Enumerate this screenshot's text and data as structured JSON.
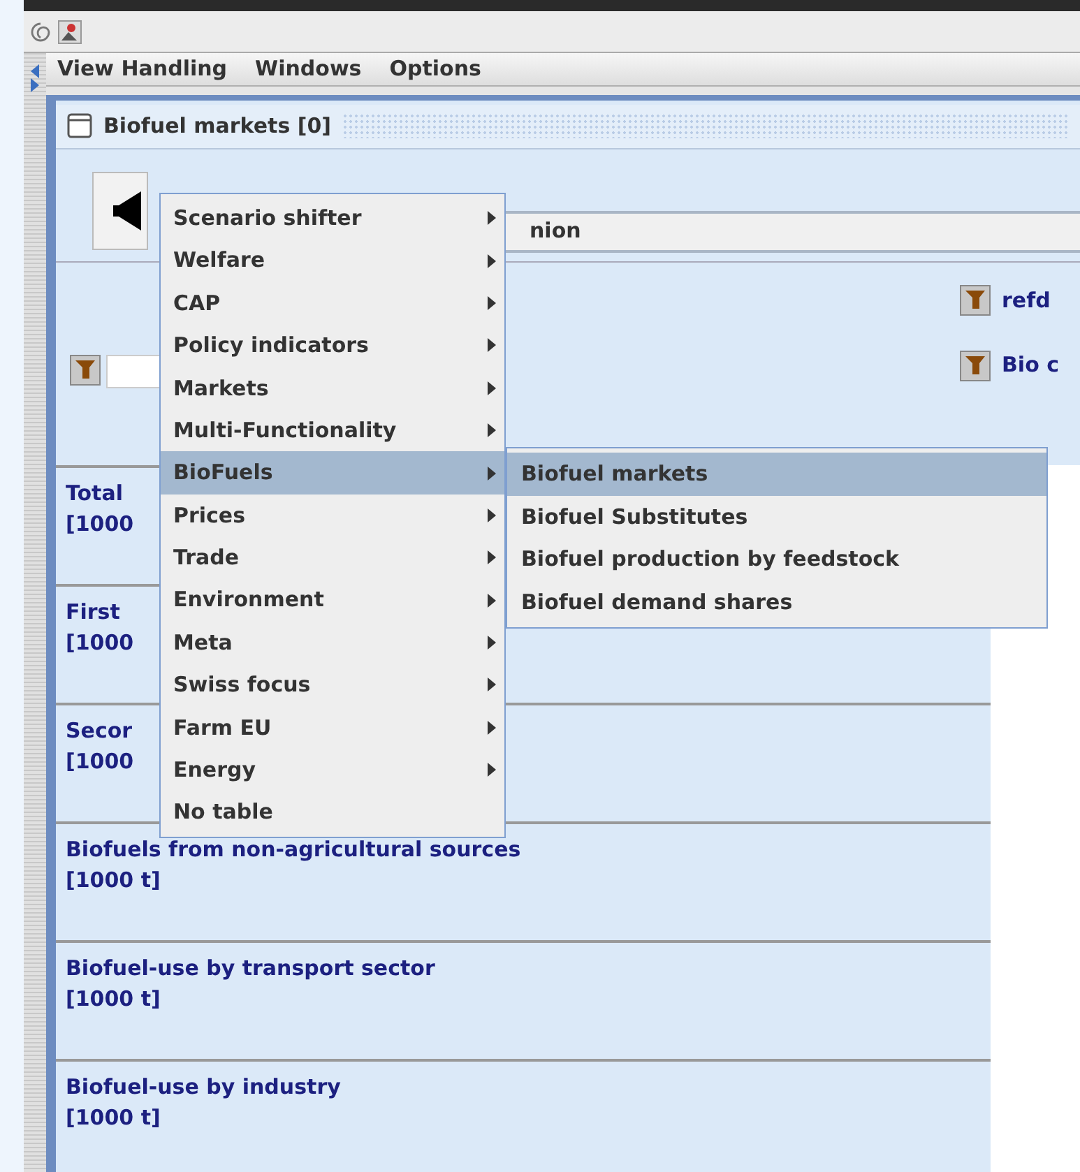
{
  "menubar": [
    {
      "label": "View Handling"
    },
    {
      "label": "Windows"
    },
    {
      "label": "Options"
    }
  ],
  "frame": {
    "title": "Biofuel markets [0]"
  },
  "combo": {
    "value": "nion"
  },
  "side_links": [
    {
      "label": "refd"
    },
    {
      "label": "Bio c"
    }
  ],
  "rows": [
    {
      "title": "Total",
      "unit": "[1000"
    },
    {
      "title": "First",
      "unit": "[1000"
    },
    {
      "title": "Secor",
      "unit": "[1000"
    },
    {
      "title": "Biofuels from non-agricultural sources",
      "unit": "[1000 t]"
    },
    {
      "title": "Biofuel-use by transport sector",
      "unit": "[1000 t]"
    },
    {
      "title": "Biofuel-use by industry",
      "unit": "[1000 t]"
    }
  ],
  "menu": [
    {
      "label": "Scenario shifter",
      "submenu": true,
      "selected": false
    },
    {
      "label": "Welfare",
      "submenu": true,
      "selected": false
    },
    {
      "label": "CAP",
      "submenu": true,
      "selected": false
    },
    {
      "label": "Policy indicators",
      "submenu": true,
      "selected": false
    },
    {
      "label": "Markets",
      "submenu": true,
      "selected": false
    },
    {
      "label": "Multi-Functionality",
      "submenu": true,
      "selected": false
    },
    {
      "label": "BioFuels",
      "submenu": true,
      "selected": true
    },
    {
      "label": "Prices",
      "submenu": true,
      "selected": false
    },
    {
      "label": "Trade",
      "submenu": true,
      "selected": false
    },
    {
      "label": "Environment",
      "submenu": true,
      "selected": false
    },
    {
      "label": "Meta",
      "submenu": true,
      "selected": false
    },
    {
      "label": "Swiss focus",
      "submenu": true,
      "selected": false
    },
    {
      "label": "Farm EU",
      "submenu": true,
      "selected": false
    },
    {
      "label": "Energy",
      "submenu": true,
      "selected": false
    },
    {
      "label": "No table",
      "submenu": false,
      "selected": false
    }
  ],
  "submenu": [
    {
      "label": "Biofuel markets",
      "selected": true
    },
    {
      "label": "Biofuel Substitutes",
      "selected": false
    },
    {
      "label": "Biofuel production by feedstock",
      "selected": false
    },
    {
      "label": "Biofuel demand shares",
      "selected": false
    }
  ]
}
